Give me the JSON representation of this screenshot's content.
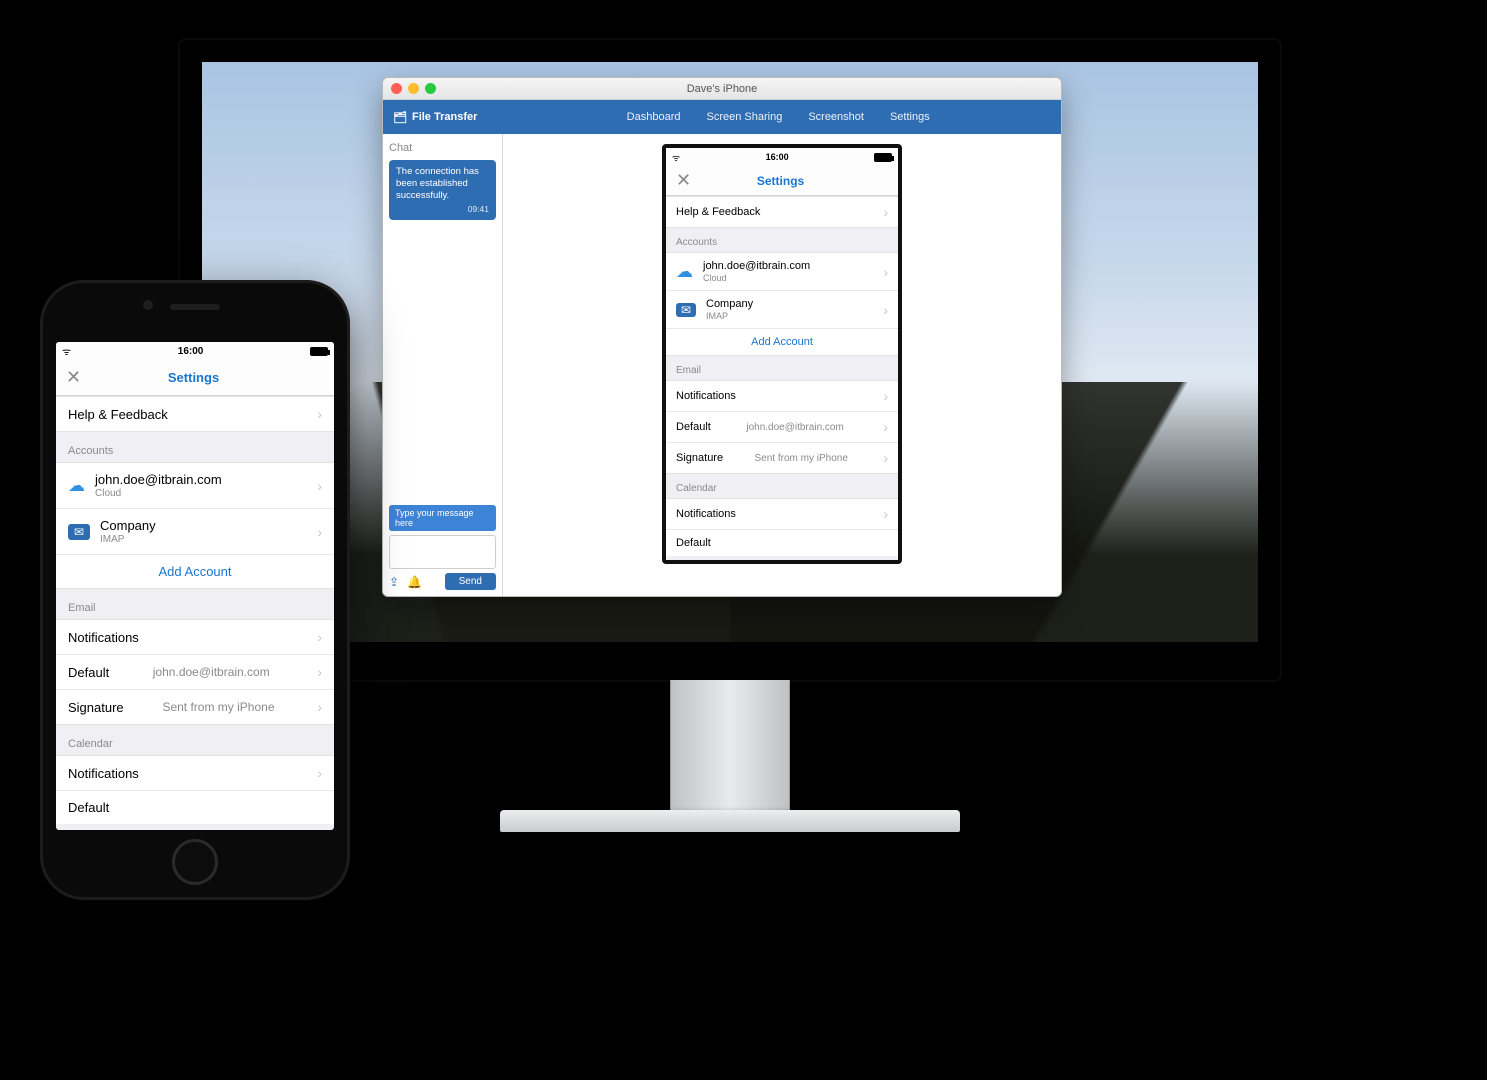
{
  "window": {
    "title": "Dave's iPhone",
    "brand": "File Transfer",
    "tabs": {
      "dashboard": "Dashboard",
      "screenshare": "Screen Sharing",
      "screenshot": "Screenshot",
      "settings": "Settings"
    }
  },
  "chat": {
    "title": "Chat",
    "message": "The connection has been established successfully.",
    "message_time": "09:41",
    "hint": "Type your message here",
    "send": "Send"
  },
  "ios": {
    "time": "16:00",
    "nav_title": "Settings",
    "help": "Help & Feedback",
    "accounts_hdr": "Accounts",
    "account1": {
      "email": "john.doe@itbrain.com",
      "kind": "Cloud"
    },
    "account2": {
      "name": "Company",
      "kind": "IMAP"
    },
    "add_account": "Add Account",
    "email_hdr": "Email",
    "notifications": "Notifications",
    "default_label": "Default",
    "default_value": "john.doe@itbrain.com",
    "signature_label": "Signature",
    "signature_value": "Sent from my iPhone",
    "calendar_hdr": "Calendar",
    "cal_notifications": "Notifications",
    "cal_default": "Default"
  }
}
